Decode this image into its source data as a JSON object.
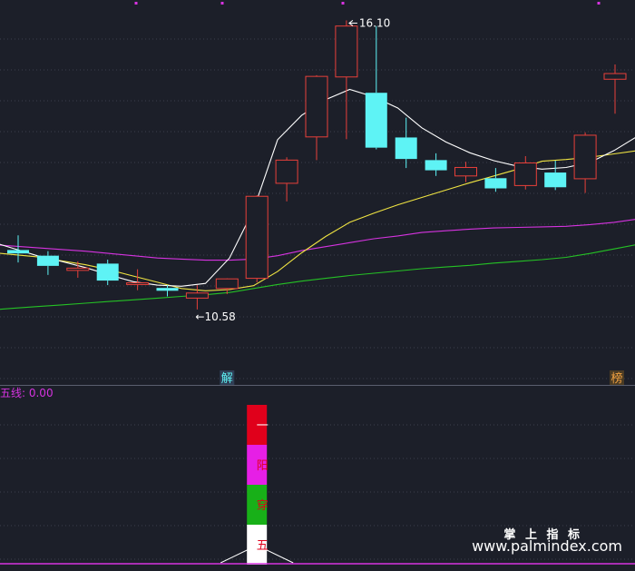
{
  "chart_data": [
    {
      "type": "candlestick",
      "panel": "main",
      "ylim": [
        9.8,
        16.3
      ],
      "colors": {
        "up": "#e8403a",
        "down": "#5ef3f5",
        "ma5": "#ffffff",
        "ma10": "#f0e442",
        "ma20": "#d633e0",
        "ma60": "#25c225"
      },
      "candles": [
        {
          "o": 12.04,
          "h": 12.3,
          "l": 11.82,
          "c": 11.98
        },
        {
          "o": 11.94,
          "h": 12.02,
          "l": 11.6,
          "c": 11.76
        },
        {
          "o": 11.68,
          "h": 11.84,
          "l": 11.55,
          "c": 11.72
        },
        {
          "o": 11.8,
          "h": 11.87,
          "l": 11.42,
          "c": 11.5
        },
        {
          "o": 11.43,
          "h": 11.7,
          "l": 11.33,
          "c": 11.46
        },
        {
          "o": 11.37,
          "h": 11.42,
          "l": 11.22,
          "c": 11.32
        },
        {
          "o": 11.19,
          "h": 11.42,
          "l": 10.99,
          "c": 11.28
        },
        {
          "o": 11.36,
          "h": 11.54,
          "l": 11.26,
          "c": 11.53
        },
        {
          "o": 11.54,
          "h": 13.01,
          "l": 11.47,
          "c": 12.99
        },
        {
          "o": 13.22,
          "h": 13.68,
          "l": 12.9,
          "c": 13.63
        },
        {
          "o": 14.04,
          "h": 15.13,
          "l": 13.63,
          "c": 15.11
        },
        {
          "o": 15.1,
          "h": 16.1,
          "l": 14.0,
          "c": 16.0
        },
        {
          "o": 14.82,
          "h": 16.0,
          "l": 13.82,
          "c": 13.85
        },
        {
          "o": 14.03,
          "h": 14.38,
          "l": 13.49,
          "c": 13.65
        },
        {
          "o": 13.63,
          "h": 13.75,
          "l": 13.35,
          "c": 13.45
        },
        {
          "o": 13.35,
          "h": 13.6,
          "l": 13.24,
          "c": 13.5
        },
        {
          "o": 13.31,
          "h": 13.49,
          "l": 13.07,
          "c": 13.13
        },
        {
          "o": 13.18,
          "h": 13.7,
          "l": 13.11,
          "c": 13.58
        },
        {
          "o": 13.41,
          "h": 13.62,
          "l": 13.1,
          "c": 13.15
        },
        {
          "o": 13.3,
          "h": 14.12,
          "l": 13.05,
          "c": 14.07
        },
        {
          "o": 15.06,
          "h": 15.32,
          "l": 14.45,
          "c": 15.16
        }
      ],
      "ma5": [
        12.2,
        12.07,
        11.94,
        11.84,
        11.73,
        11.6,
        11.48,
        11.42,
        11.4,
        11.45,
        11.9,
        12.75,
        13.99,
        14.42,
        14.7,
        14.88,
        14.75,
        14.55,
        14.2,
        13.95,
        13.76,
        13.62,
        13.52,
        13.47,
        13.5,
        13.59,
        13.8,
        14.06
      ],
      "ma10": [
        12.0,
        11.96,
        11.92,
        11.85,
        11.78,
        11.69,
        11.58,
        11.47,
        11.36,
        11.32,
        11.34,
        11.41,
        11.66,
        11.99,
        12.28,
        12.53,
        12.69,
        12.84,
        12.97,
        13.1,
        13.23,
        13.35,
        13.47,
        13.61,
        13.64,
        13.68,
        13.74,
        13.8
      ],
      "ma20": [
        12.14,
        12.11,
        12.08,
        12.05,
        12.02,
        11.98,
        11.94,
        11.9,
        11.88,
        11.86,
        11.86,
        11.88,
        11.94,
        12.03,
        12.1,
        12.17,
        12.24,
        12.29,
        12.35,
        12.38,
        12.41,
        12.43,
        12.44,
        12.45,
        12.46,
        12.49,
        12.53,
        12.59
      ],
      "ma60": [
        10.98,
        11.01,
        11.04,
        11.07,
        11.1,
        11.13,
        11.16,
        11.19,
        11.22,
        11.25,
        11.29,
        11.36,
        11.43,
        11.49,
        11.54,
        11.59,
        11.63,
        11.67,
        11.71,
        11.74,
        11.77,
        11.81,
        11.84,
        11.87,
        11.91,
        11.98,
        12.06,
        12.14
      ],
      "annotations": {
        "high_label": "16.10",
        "low_label": "10.58",
        "low_value": 11.0,
        "arrow": "←"
      },
      "markers": [
        {
          "index": 7,
          "text": "解"
        },
        {
          "index": 20,
          "text": "榜"
        }
      ]
    },
    {
      "type": "bar",
      "panel": "indicator",
      "title": "五线: 0.00",
      "bar_index": 8,
      "segments": [
        {
          "label": "一",
          "color": "#e0001b"
        },
        {
          "label": "阳",
          "color": "#e61fe6"
        },
        {
          "label": "穿",
          "color": "#18b018"
        },
        {
          "label": "五",
          "color": "#ffffff"
        }
      ]
    }
  ],
  "watermark": {
    "line1": "掌 上 指 标",
    "line2": "www.palmindex.com"
  }
}
